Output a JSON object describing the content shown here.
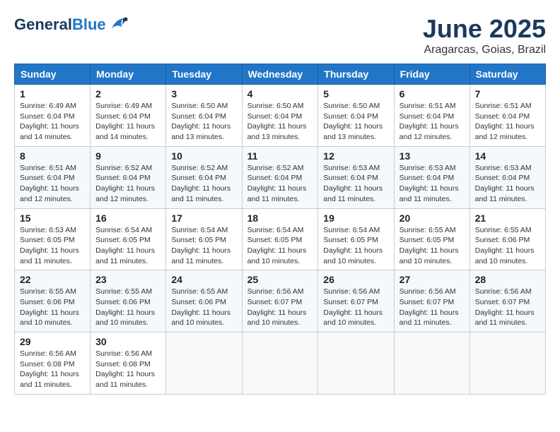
{
  "header": {
    "logo_general": "General",
    "logo_blue": "Blue",
    "month": "June 2025",
    "location": "Aragarcas, Goias, Brazil"
  },
  "weekdays": [
    "Sunday",
    "Monday",
    "Tuesday",
    "Wednesday",
    "Thursday",
    "Friday",
    "Saturday"
  ],
  "weeks": [
    [
      {
        "day": "1",
        "info": "Sunrise: 6:49 AM\nSunset: 6:04 PM\nDaylight: 11 hours\nand 14 minutes."
      },
      {
        "day": "2",
        "info": "Sunrise: 6:49 AM\nSunset: 6:04 PM\nDaylight: 11 hours\nand 14 minutes."
      },
      {
        "day": "3",
        "info": "Sunrise: 6:50 AM\nSunset: 6:04 PM\nDaylight: 11 hours\nand 13 minutes."
      },
      {
        "day": "4",
        "info": "Sunrise: 6:50 AM\nSunset: 6:04 PM\nDaylight: 11 hours\nand 13 minutes."
      },
      {
        "day": "5",
        "info": "Sunrise: 6:50 AM\nSunset: 6:04 PM\nDaylight: 11 hours\nand 13 minutes."
      },
      {
        "day": "6",
        "info": "Sunrise: 6:51 AM\nSunset: 6:04 PM\nDaylight: 11 hours\nand 12 minutes."
      },
      {
        "day": "7",
        "info": "Sunrise: 6:51 AM\nSunset: 6:04 PM\nDaylight: 11 hours\nand 12 minutes."
      }
    ],
    [
      {
        "day": "8",
        "info": "Sunrise: 6:51 AM\nSunset: 6:04 PM\nDaylight: 11 hours\nand 12 minutes."
      },
      {
        "day": "9",
        "info": "Sunrise: 6:52 AM\nSunset: 6:04 PM\nDaylight: 11 hours\nand 12 minutes."
      },
      {
        "day": "10",
        "info": "Sunrise: 6:52 AM\nSunset: 6:04 PM\nDaylight: 11 hours\nand 11 minutes."
      },
      {
        "day": "11",
        "info": "Sunrise: 6:52 AM\nSunset: 6:04 PM\nDaylight: 11 hours\nand 11 minutes."
      },
      {
        "day": "12",
        "info": "Sunrise: 6:53 AM\nSunset: 6:04 PM\nDaylight: 11 hours\nand 11 minutes."
      },
      {
        "day": "13",
        "info": "Sunrise: 6:53 AM\nSunset: 6:04 PM\nDaylight: 11 hours\nand 11 minutes."
      },
      {
        "day": "14",
        "info": "Sunrise: 6:53 AM\nSunset: 6:04 PM\nDaylight: 11 hours\nand 11 minutes."
      }
    ],
    [
      {
        "day": "15",
        "info": "Sunrise: 6:53 AM\nSunset: 6:05 PM\nDaylight: 11 hours\nand 11 minutes."
      },
      {
        "day": "16",
        "info": "Sunrise: 6:54 AM\nSunset: 6:05 PM\nDaylight: 11 hours\nand 11 minutes."
      },
      {
        "day": "17",
        "info": "Sunrise: 6:54 AM\nSunset: 6:05 PM\nDaylight: 11 hours\nand 11 minutes."
      },
      {
        "day": "18",
        "info": "Sunrise: 6:54 AM\nSunset: 6:05 PM\nDaylight: 11 hours\nand 10 minutes."
      },
      {
        "day": "19",
        "info": "Sunrise: 6:54 AM\nSunset: 6:05 PM\nDaylight: 11 hours\nand 10 minutes."
      },
      {
        "day": "20",
        "info": "Sunrise: 6:55 AM\nSunset: 6:05 PM\nDaylight: 11 hours\nand 10 minutes."
      },
      {
        "day": "21",
        "info": "Sunrise: 6:55 AM\nSunset: 6:06 PM\nDaylight: 11 hours\nand 10 minutes."
      }
    ],
    [
      {
        "day": "22",
        "info": "Sunrise: 6:55 AM\nSunset: 6:06 PM\nDaylight: 11 hours\nand 10 minutes."
      },
      {
        "day": "23",
        "info": "Sunrise: 6:55 AM\nSunset: 6:06 PM\nDaylight: 11 hours\nand 10 minutes."
      },
      {
        "day": "24",
        "info": "Sunrise: 6:55 AM\nSunset: 6:06 PM\nDaylight: 11 hours\nand 10 minutes."
      },
      {
        "day": "25",
        "info": "Sunrise: 6:56 AM\nSunset: 6:07 PM\nDaylight: 11 hours\nand 10 minutes."
      },
      {
        "day": "26",
        "info": "Sunrise: 6:56 AM\nSunset: 6:07 PM\nDaylight: 11 hours\nand 10 minutes."
      },
      {
        "day": "27",
        "info": "Sunrise: 6:56 AM\nSunset: 6:07 PM\nDaylight: 11 hours\nand 11 minutes."
      },
      {
        "day": "28",
        "info": "Sunrise: 6:56 AM\nSunset: 6:07 PM\nDaylight: 11 hours\nand 11 minutes."
      }
    ],
    [
      {
        "day": "29",
        "info": "Sunrise: 6:56 AM\nSunset: 6:08 PM\nDaylight: 11 hours\nand 11 minutes."
      },
      {
        "day": "30",
        "info": "Sunrise: 6:56 AM\nSunset: 6:08 PM\nDaylight: 11 hours\nand 11 minutes."
      },
      {
        "day": "",
        "info": ""
      },
      {
        "day": "",
        "info": ""
      },
      {
        "day": "",
        "info": ""
      },
      {
        "day": "",
        "info": ""
      },
      {
        "day": "",
        "info": ""
      }
    ]
  ]
}
